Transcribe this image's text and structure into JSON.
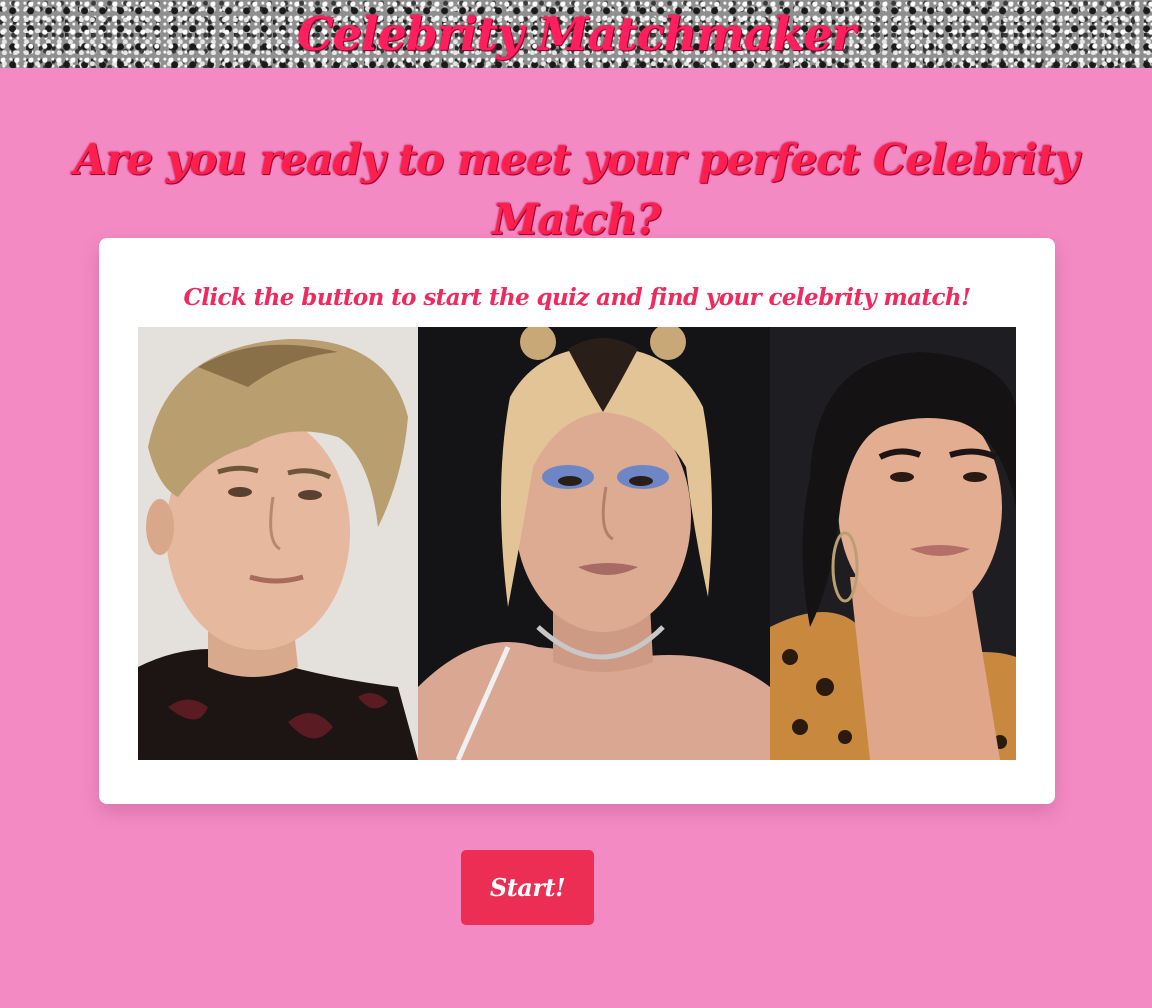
{
  "header": {
    "title": "Celebrity Matchmaker"
  },
  "main": {
    "tagline": "Are you ready to meet your perfect Celebrity Match?",
    "card": {
      "instructions": "Click the button to start the quiz and find your celebrity match!",
      "photos": [
        {
          "subject": "young man with blond swept hair, dark patterned sweater"
        },
        {
          "subject": "woman with blond fringe and dark roots, blue eye makeup, chain necklace"
        },
        {
          "subject": "woman with dark slicked-back hair, hoop earrings, leopard-print top"
        }
      ]
    },
    "start_button_label": "Start!"
  },
  "colors": {
    "page_background": "#f48ac4",
    "title_pink": "#ff1f5e",
    "button_background": "#ec2e55",
    "card_background": "#ffffff"
  }
}
